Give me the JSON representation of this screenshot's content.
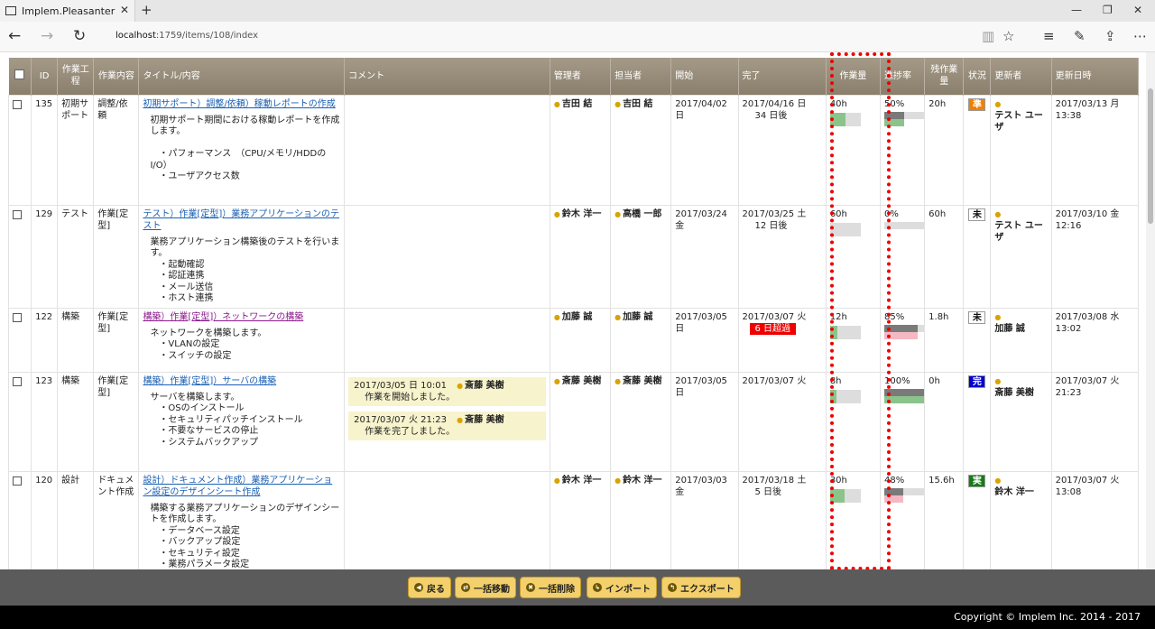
{
  "browser": {
    "tab_title": "Implem.Pleasanter",
    "url_host": "localhost",
    "url_rest": ":1759/items/108/index"
  },
  "table": {
    "headers": {
      "id": "ID",
      "process": "作業工程",
      "content": "作業内容",
      "title": "タイトル/内容",
      "comment": "コメント",
      "manager": "管理者",
      "owner": "担当者",
      "start": "開始",
      "end": "完了",
      "work": "作業量",
      "progress": "進捗率",
      "remain": "残作業量",
      "status": "状況",
      "updator": "更新者",
      "updated": "更新日時"
    },
    "rows": [
      {
        "id": "135",
        "process": "初期サポート",
        "content": "調整/依頼",
        "title": "初期サポート）調整/依頼）稼動レポートの作成",
        "visited": false,
        "body": "初期サポート期間における稼動レポートを作成します。\n\n　・パフォーマンス　（CPU/メモリ/HDDのI/O）\n　・ユーザアクセス数",
        "comments": [],
        "manager": "吉田 結",
        "owner": "吉田 結",
        "start": "2017/04/02 日",
        "end": "2017/04/16 日",
        "end_note": "34 日後",
        "overdue": false,
        "work": "40h",
        "work_fill": 0.5,
        "progress": "50%",
        "progress_value": 0.5,
        "progress_bottom_color": "#8bc48b",
        "remain": "20h",
        "status": "準",
        "status_bg": "#f08000",
        "status_fg": "#ffffff",
        "updator": "テスト ユーザ",
        "updated": "2017/03/13 月 13:38"
      },
      {
        "id": "129",
        "process": "テスト",
        "content": "作業[定型]",
        "title": "テスト）作業[定型]）業務アプリケーションのテスト",
        "visited": false,
        "body": "業務アプリケーション構築後のテストを行います。\n　・起動確認\n　・認証連携\n　・メール送信\n　・ホスト連携",
        "comments": [],
        "manager": "鈴木 洋一",
        "owner": "高橋 一郎",
        "start": "2017/03/24 金",
        "end": "2017/03/25 土",
        "end_note": "12 日後",
        "overdue": false,
        "work": "60h",
        "work_fill": 0,
        "progress": "0%",
        "progress_value": 0,
        "progress_bottom_color": "#dddddd",
        "remain": "60h",
        "status": "未",
        "status_bg": "#ffffff",
        "status_fg": "#111111",
        "updator": "テスト ユーザ",
        "updated": "2017/03/10 金 12:16"
      },
      {
        "id": "122",
        "process": "構築",
        "content": "作業[定型]",
        "title": "構築）作業[定型]）ネットワークの構築",
        "visited": true,
        "body": "ネットワークを構築します。\n　・VLANの設定\n　・スイッチの設定",
        "comments": [],
        "manager": "加藤 誠",
        "owner": "加藤 誠",
        "start": "2017/03/05 日",
        "end": "2017/03/07 火",
        "end_note": "6 日超過",
        "overdue": true,
        "work": "12h",
        "work_fill": 0.25,
        "progress": "85%",
        "progress_value": 0.85,
        "progress_bottom_color": "#f4b8c4",
        "remain": "1.8h",
        "status": "未",
        "status_bg": "#ffffff",
        "status_fg": "#111111",
        "updator": "加藤 誠",
        "updated": "2017/03/08 水 13:02"
      },
      {
        "id": "123",
        "process": "構築",
        "content": "作業[定型]",
        "title": "構築）作業[定型]）サーバの構築",
        "visited": false,
        "body": "サーバを構築します。\n　・OSのインストール\n　・セキュリティパッチインストール\n　・不要なサービスの停止\n　・システムバックアップ",
        "comments": [
          {
            "date": "2017/03/05 日 10:01",
            "user": "斎藤 美樹",
            "text": "作業を開始しました。"
          },
          {
            "date": "2017/03/07 火 21:23",
            "user": "斎藤 美樹",
            "text": "作業を完了しました。"
          }
        ],
        "manager": "斎藤 美樹",
        "owner": "斎藤 美樹",
        "start": "2017/03/05 日",
        "end": "2017/03/07 火",
        "end_note": "",
        "overdue": false,
        "work": "8h",
        "work_fill": 0.2,
        "progress": "100%",
        "progress_value": 1.0,
        "progress_bottom_color": "#8bc48b",
        "remain": "0h",
        "status": "完",
        "status_bg": "#0000cc",
        "status_fg": "#ffffff",
        "updator": "斎藤 美樹",
        "updated": "2017/03/07 火 21:23"
      },
      {
        "id": "120",
        "process": "設計",
        "content": "ドキュメント作成",
        "title": "設計）ドキュメント作成）業務アプリケーション設定のデザインシート作成",
        "visited": false,
        "body": "構築する業務アプリケーションのデザインシートを作成します。\n　・データベース設定\n　・バックアップ設定\n　・セキュリティ設定\n　・業務パラメータ設定\n\nファイルの保存先は以下です。",
        "comments": [],
        "manager": "鈴木 洋一",
        "owner": "鈴木 洋一",
        "start": "2017/03/03 金",
        "end": "2017/03/18 土",
        "end_note": "5 日後",
        "overdue": false,
        "work": "30h",
        "work_fill": 0.48,
        "progress": "48%",
        "progress_value": 0.48,
        "progress_bottom_color": "#f4b8c4",
        "remain": "15.6h",
        "status": "実",
        "status_bg": "#1a7a1a",
        "status_fg": "#ffffff",
        "updator": "鈴木 洋一",
        "updated": "2017/03/07 火 13:08"
      }
    ]
  },
  "commands": {
    "back": "戻る",
    "bulk_move": "一括移動",
    "bulk_delete": "一括削除",
    "import": "インポート",
    "export": "エクスポート"
  },
  "footer": {
    "copyright": "Copyright © Implem Inc. 2014 - 2017"
  },
  "colors": {
    "header_bg": "#9a8f7c",
    "command_bg": "#5b5b5b",
    "highlight": "#e00000"
  }
}
